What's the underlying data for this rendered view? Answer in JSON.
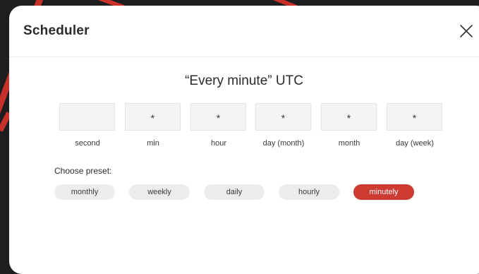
{
  "dialog": {
    "title": "Scheduler",
    "expression": "“Every minute” UTC"
  },
  "fields": [
    {
      "value": "",
      "label": "second"
    },
    {
      "value": "*",
      "label": "min"
    },
    {
      "value": "*",
      "label": "hour"
    },
    {
      "value": "*",
      "label": "day (month)"
    },
    {
      "value": "*",
      "label": "month"
    },
    {
      "value": "*",
      "label": "day (week)"
    }
  ],
  "presets": {
    "title": "Choose preset:",
    "items": [
      {
        "label": "monthly",
        "selected": false
      },
      {
        "label": "weekly",
        "selected": false
      },
      {
        "label": "daily",
        "selected": false
      },
      {
        "label": "hourly",
        "selected": false
      },
      {
        "label": "minutely",
        "selected": true
      }
    ]
  },
  "colors": {
    "accent": "#cf3a33",
    "backdrop": "#1e1e20"
  },
  "icons": {
    "close": "close-icon"
  }
}
